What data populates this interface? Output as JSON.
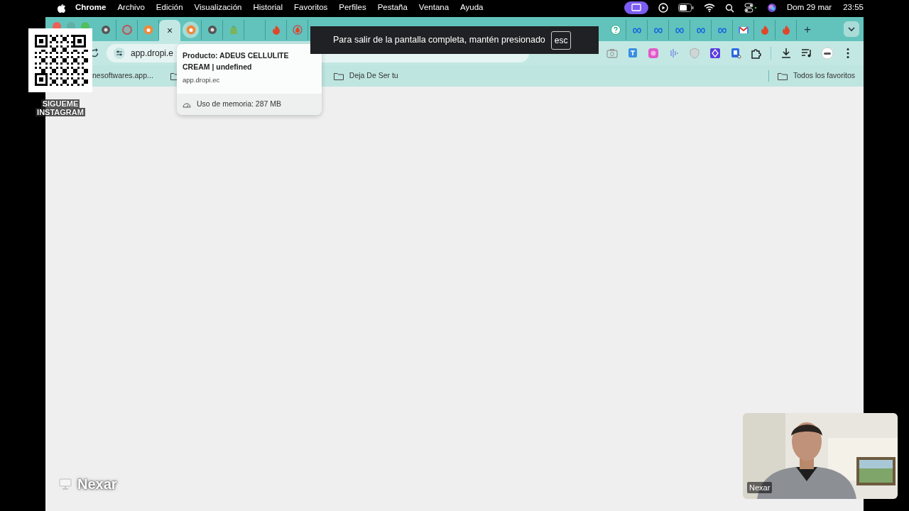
{
  "menu_bar": {
    "app": "Chrome",
    "items": [
      "Archivo",
      "Edición",
      "Visualización",
      "Historial",
      "Favoritos",
      "Perfiles",
      "Pestaña",
      "Ventana",
      "Ayuda"
    ],
    "date": "Dom 29 mar",
    "time": "23:55"
  },
  "tab_strip": {
    "leading_tabs": [
      {
        "selected": false,
        "hovered": false
      },
      {
        "selected": false,
        "hovered": false
      },
      {
        "selected": false,
        "hovered": false
      },
      {
        "selected": true,
        "hovered": false,
        "close_label": "×"
      },
      {
        "selected": false,
        "hovered": true
      },
      {
        "selected": false,
        "hovered": false
      },
      {
        "selected": false,
        "hovered": false
      },
      {
        "selected": false,
        "hovered": false
      },
      {
        "selected": false,
        "hovered": false
      },
      {
        "selected": false,
        "hovered": false
      }
    ],
    "trailing_tabs": [
      {
        "selected": false,
        "hovered": false
      },
      {
        "selected": false,
        "hovered": false
      },
      {
        "selected": false,
        "hovered": false
      },
      {
        "selected": false,
        "hovered": false
      },
      {
        "selected": false,
        "hovered": false
      },
      {
        "selected": false,
        "hovered": false
      },
      {
        "selected": false,
        "hovered": false
      },
      {
        "selected": false,
        "hovered": false
      },
      {
        "selected": false,
        "hovered": false
      }
    ],
    "new_tab_label": "+"
  },
  "toolbar": {
    "address": "app.dropi.e"
  },
  "bookmarks": {
    "items": [
      {
        "label": "nesoftwares.app...",
        "folder": false
      },
      {
        "folder": true
      },
      {
        "label": "Deja De Ser tu",
        "folder": true
      }
    ],
    "all_label": "Todos los favoritos"
  },
  "tab_tooltip": {
    "title": "Producto: ADEUS CELLULITE CREAM | undefined",
    "url": "app.dropi.ec",
    "memory": "Uso de memoria: 287 MB"
  },
  "fullscreen_toast": {
    "message": "Para salir de la pantalla completa, mantén presionado",
    "key": "esc"
  },
  "qr_overlay": {
    "caption_lines": [
      "SIGUEME",
      "INSTAGRAM"
    ]
  },
  "presenter_label": "Nexar",
  "webcam": {
    "kind": "picture",
    "name": "Nexar"
  }
}
